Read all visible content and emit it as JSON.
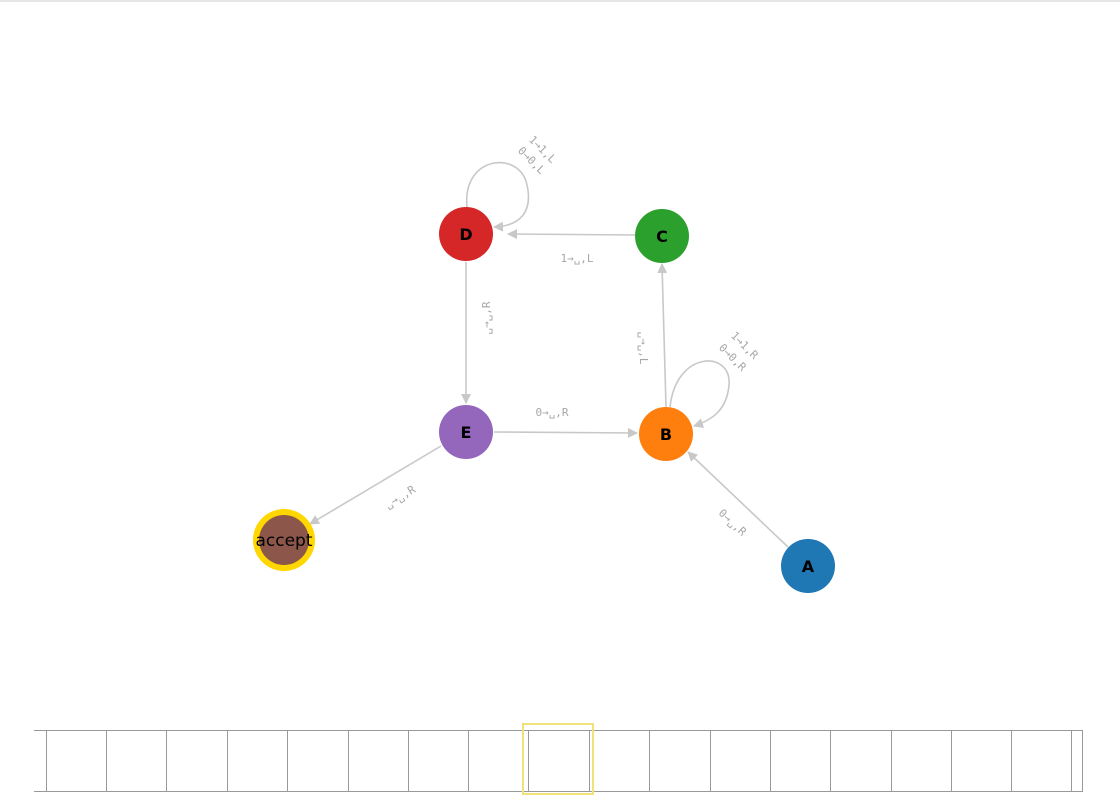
{
  "states": [
    {
      "id": "A",
      "label": "A",
      "color": "#1f77b4"
    },
    {
      "id": "B",
      "label": "B",
      "color": "#ff7f0e"
    },
    {
      "id": "C",
      "label": "C",
      "color": "#2ca02c"
    },
    {
      "id": "D",
      "label": "D",
      "color": "#d62728"
    },
    {
      "id": "E",
      "label": "E",
      "color": "#9467bd"
    },
    {
      "id": "accept",
      "label": "accept",
      "color": "#8c564b",
      "ring_color": "#ffd700"
    }
  ],
  "transitions": {
    "A_B": {
      "from": "A",
      "to": "B",
      "label": "0→␣,R"
    },
    "B_B": {
      "from": "B",
      "to": "B",
      "lines": [
        "1→1,R",
        "0→0,R"
      ]
    },
    "B_C": {
      "from": "B",
      "to": "C",
      "label": "␣→␣,L"
    },
    "C_D": {
      "from": "C",
      "to": "D",
      "label": "1→␣,L"
    },
    "D_D": {
      "from": "D",
      "to": "D",
      "lines": [
        "1→1,L",
        "0→0,L"
      ]
    },
    "D_E": {
      "from": "D",
      "to": "E",
      "label": "␣→␣,R"
    },
    "E_B": {
      "from": "E",
      "to": "B",
      "label": "0→␣,R"
    },
    "E_accept": {
      "from": "E",
      "to": "accept",
      "label": "␣→␣,R"
    }
  },
  "tape": {
    "cells": [
      "",
      "",
      "",
      "",
      "",
      "",
      "",
      "",
      "",
      "",
      "",
      "",
      "",
      "",
      "",
      "",
      "",
      ""
    ],
    "head_index": 8,
    "head_color": "#f2e079"
  }
}
